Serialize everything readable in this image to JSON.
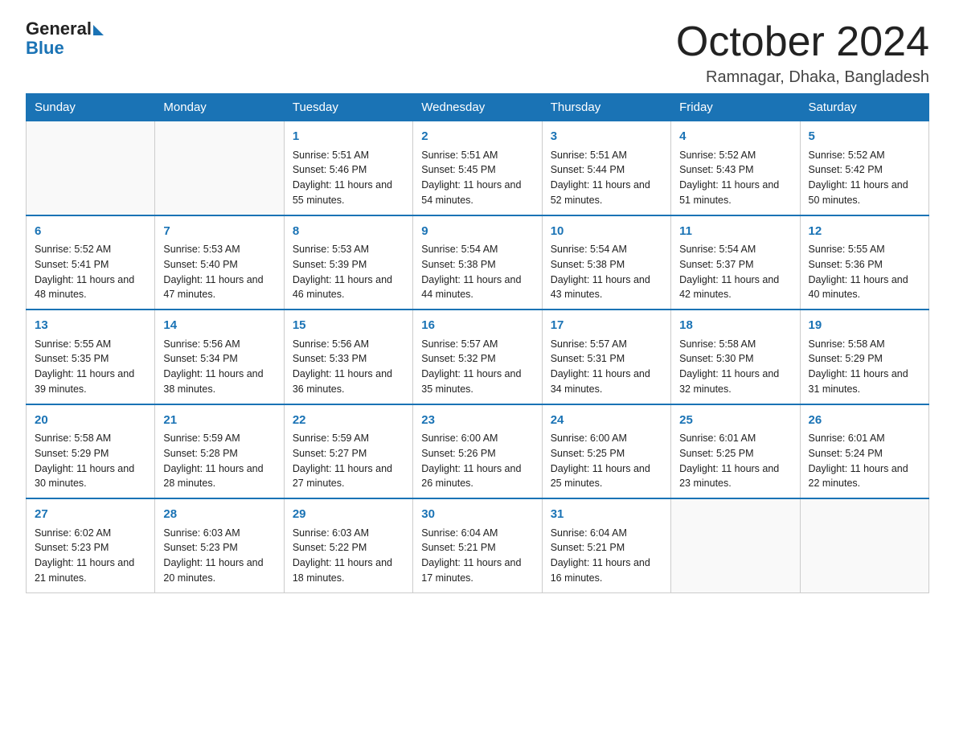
{
  "header": {
    "logo": {
      "line1": "General",
      "line2": "Blue"
    },
    "title": "October 2024",
    "location": "Ramnagar, Dhaka, Bangladesh"
  },
  "days_of_week": [
    "Sunday",
    "Monday",
    "Tuesday",
    "Wednesday",
    "Thursday",
    "Friday",
    "Saturday"
  ],
  "weeks": [
    [
      {
        "day": "",
        "sunrise": "",
        "sunset": "",
        "daylight": ""
      },
      {
        "day": "",
        "sunrise": "",
        "sunset": "",
        "daylight": ""
      },
      {
        "day": "1",
        "sunrise": "Sunrise: 5:51 AM",
        "sunset": "Sunset: 5:46 PM",
        "daylight": "Daylight: 11 hours and 55 minutes."
      },
      {
        "day": "2",
        "sunrise": "Sunrise: 5:51 AM",
        "sunset": "Sunset: 5:45 PM",
        "daylight": "Daylight: 11 hours and 54 minutes."
      },
      {
        "day": "3",
        "sunrise": "Sunrise: 5:51 AM",
        "sunset": "Sunset: 5:44 PM",
        "daylight": "Daylight: 11 hours and 52 minutes."
      },
      {
        "day": "4",
        "sunrise": "Sunrise: 5:52 AM",
        "sunset": "Sunset: 5:43 PM",
        "daylight": "Daylight: 11 hours and 51 minutes."
      },
      {
        "day": "5",
        "sunrise": "Sunrise: 5:52 AM",
        "sunset": "Sunset: 5:42 PM",
        "daylight": "Daylight: 11 hours and 50 minutes."
      }
    ],
    [
      {
        "day": "6",
        "sunrise": "Sunrise: 5:52 AM",
        "sunset": "Sunset: 5:41 PM",
        "daylight": "Daylight: 11 hours and 48 minutes."
      },
      {
        "day": "7",
        "sunrise": "Sunrise: 5:53 AM",
        "sunset": "Sunset: 5:40 PM",
        "daylight": "Daylight: 11 hours and 47 minutes."
      },
      {
        "day": "8",
        "sunrise": "Sunrise: 5:53 AM",
        "sunset": "Sunset: 5:39 PM",
        "daylight": "Daylight: 11 hours and 46 minutes."
      },
      {
        "day": "9",
        "sunrise": "Sunrise: 5:54 AM",
        "sunset": "Sunset: 5:38 PM",
        "daylight": "Daylight: 11 hours and 44 minutes."
      },
      {
        "day": "10",
        "sunrise": "Sunrise: 5:54 AM",
        "sunset": "Sunset: 5:38 PM",
        "daylight": "Daylight: 11 hours and 43 minutes."
      },
      {
        "day": "11",
        "sunrise": "Sunrise: 5:54 AM",
        "sunset": "Sunset: 5:37 PM",
        "daylight": "Daylight: 11 hours and 42 minutes."
      },
      {
        "day": "12",
        "sunrise": "Sunrise: 5:55 AM",
        "sunset": "Sunset: 5:36 PM",
        "daylight": "Daylight: 11 hours and 40 minutes."
      }
    ],
    [
      {
        "day": "13",
        "sunrise": "Sunrise: 5:55 AM",
        "sunset": "Sunset: 5:35 PM",
        "daylight": "Daylight: 11 hours and 39 minutes."
      },
      {
        "day": "14",
        "sunrise": "Sunrise: 5:56 AM",
        "sunset": "Sunset: 5:34 PM",
        "daylight": "Daylight: 11 hours and 38 minutes."
      },
      {
        "day": "15",
        "sunrise": "Sunrise: 5:56 AM",
        "sunset": "Sunset: 5:33 PM",
        "daylight": "Daylight: 11 hours and 36 minutes."
      },
      {
        "day": "16",
        "sunrise": "Sunrise: 5:57 AM",
        "sunset": "Sunset: 5:32 PM",
        "daylight": "Daylight: 11 hours and 35 minutes."
      },
      {
        "day": "17",
        "sunrise": "Sunrise: 5:57 AM",
        "sunset": "Sunset: 5:31 PM",
        "daylight": "Daylight: 11 hours and 34 minutes."
      },
      {
        "day": "18",
        "sunrise": "Sunrise: 5:58 AM",
        "sunset": "Sunset: 5:30 PM",
        "daylight": "Daylight: 11 hours and 32 minutes."
      },
      {
        "day": "19",
        "sunrise": "Sunrise: 5:58 AM",
        "sunset": "Sunset: 5:29 PM",
        "daylight": "Daylight: 11 hours and 31 minutes."
      }
    ],
    [
      {
        "day": "20",
        "sunrise": "Sunrise: 5:58 AM",
        "sunset": "Sunset: 5:29 PM",
        "daylight": "Daylight: 11 hours and 30 minutes."
      },
      {
        "day": "21",
        "sunrise": "Sunrise: 5:59 AM",
        "sunset": "Sunset: 5:28 PM",
        "daylight": "Daylight: 11 hours and 28 minutes."
      },
      {
        "day": "22",
        "sunrise": "Sunrise: 5:59 AM",
        "sunset": "Sunset: 5:27 PM",
        "daylight": "Daylight: 11 hours and 27 minutes."
      },
      {
        "day": "23",
        "sunrise": "Sunrise: 6:00 AM",
        "sunset": "Sunset: 5:26 PM",
        "daylight": "Daylight: 11 hours and 26 minutes."
      },
      {
        "day": "24",
        "sunrise": "Sunrise: 6:00 AM",
        "sunset": "Sunset: 5:25 PM",
        "daylight": "Daylight: 11 hours and 25 minutes."
      },
      {
        "day": "25",
        "sunrise": "Sunrise: 6:01 AM",
        "sunset": "Sunset: 5:25 PM",
        "daylight": "Daylight: 11 hours and 23 minutes."
      },
      {
        "day": "26",
        "sunrise": "Sunrise: 6:01 AM",
        "sunset": "Sunset: 5:24 PM",
        "daylight": "Daylight: 11 hours and 22 minutes."
      }
    ],
    [
      {
        "day": "27",
        "sunrise": "Sunrise: 6:02 AM",
        "sunset": "Sunset: 5:23 PM",
        "daylight": "Daylight: 11 hours and 21 minutes."
      },
      {
        "day": "28",
        "sunrise": "Sunrise: 6:03 AM",
        "sunset": "Sunset: 5:23 PM",
        "daylight": "Daylight: 11 hours and 20 minutes."
      },
      {
        "day": "29",
        "sunrise": "Sunrise: 6:03 AM",
        "sunset": "Sunset: 5:22 PM",
        "daylight": "Daylight: 11 hours and 18 minutes."
      },
      {
        "day": "30",
        "sunrise": "Sunrise: 6:04 AM",
        "sunset": "Sunset: 5:21 PM",
        "daylight": "Daylight: 11 hours and 17 minutes."
      },
      {
        "day": "31",
        "sunrise": "Sunrise: 6:04 AM",
        "sunset": "Sunset: 5:21 PM",
        "daylight": "Daylight: 11 hours and 16 minutes."
      },
      {
        "day": "",
        "sunrise": "",
        "sunset": "",
        "daylight": ""
      },
      {
        "day": "",
        "sunrise": "",
        "sunset": "",
        "daylight": ""
      }
    ]
  ]
}
